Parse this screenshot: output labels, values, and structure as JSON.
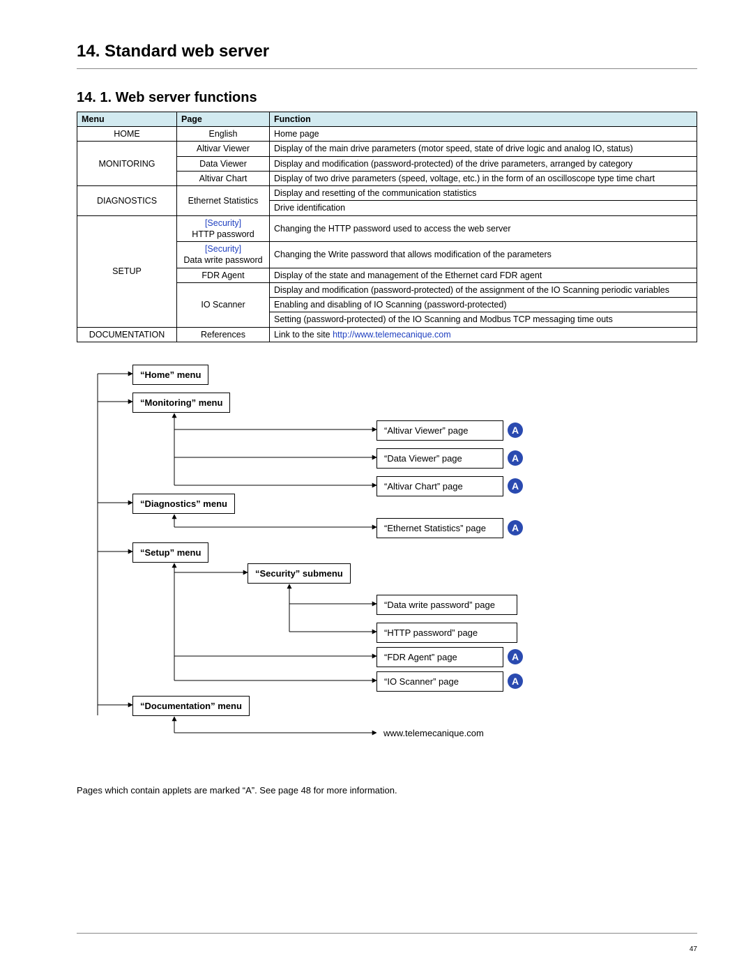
{
  "headings": {
    "h1": "14. Standard web server",
    "h2": "14. 1. Web server functions"
  },
  "table": {
    "headers": {
      "menu": "Menu",
      "page": "Page",
      "function": "Function"
    },
    "rows": {
      "home": {
        "menu": "HOME",
        "page": "English",
        "func": "Home page"
      },
      "mon_av": {
        "page": "Altivar Viewer",
        "func": "Display of the main drive parameters (motor speed, state of drive logic and analog IO, status)"
      },
      "mon_dv": {
        "menu": "MONITORING",
        "page": "Data Viewer",
        "func": "Display and modification (password-protected) of the drive parameters, arranged by category"
      },
      "mon_ac": {
        "page": "Altivar Chart",
        "func": "Display of two drive parameters (speed, voltage, etc.) in the form of an oscilloscope type time chart"
      },
      "diag_a": {
        "menu": "DIAGNOSTICS",
        "page": "Ethernet Statistics",
        "func": "Display and resetting of the communication statistics"
      },
      "diag_b": {
        "func": "Drive identification"
      },
      "setup_http": {
        "sec": "[Security]",
        "page2": "HTTP password",
        "func": "Changing the HTTP password used to access the web server"
      },
      "setup_dwp": {
        "sec": "[Security]",
        "page2": "Data write password",
        "func": "Changing the Write password that allows modification of the parameters"
      },
      "setup_menu": {
        "menu": "SETUP"
      },
      "setup_fdr": {
        "page": "FDR Agent",
        "func": "Display of the state and management of the Ethernet card FDR agent"
      },
      "setup_io1": {
        "page": "IO Scanner",
        "func": "Display and modification (password-protected) of the assignment of the IO Scanning periodic variables"
      },
      "setup_io2": {
        "func": "Enabling and disabling of IO Scanning (password-protected)"
      },
      "setup_io3": {
        "func": "Setting (password-protected) of the IO Scanning and Modbus TCP messaging time outs"
      },
      "doc": {
        "menu": "DOCUMENTATION",
        "page": "References",
        "func_pre": "Link to the site ",
        "func_url": "http://www.telemecanique.com"
      }
    }
  },
  "diagram": {
    "home_menu": "“Home” menu",
    "monitoring_menu": "“Monitoring” menu",
    "diagnostics_menu": "“Diagnostics” menu",
    "setup_menu": "“Setup” menu",
    "documentation_menu": "“Documentation” menu",
    "security_submenu": "“Security” submenu",
    "altivar_viewer": "“Altivar Viewer” page",
    "data_viewer": "“Data Viewer” page",
    "altivar_chart": "“Altivar Chart” page",
    "ethernet_stats": "“Ethernet Statistics” page",
    "dwp_page": "“Data write password” page",
    "http_page": "“HTTP password” page",
    "fdr_page": "“FDR Agent” page",
    "io_page": "“IO Scanner” page",
    "telem": "www.telemecanique.com",
    "badge": "A"
  },
  "footnote": "Pages which contain applets are marked “A”. See page 48 for more information.",
  "pagenum": "47"
}
